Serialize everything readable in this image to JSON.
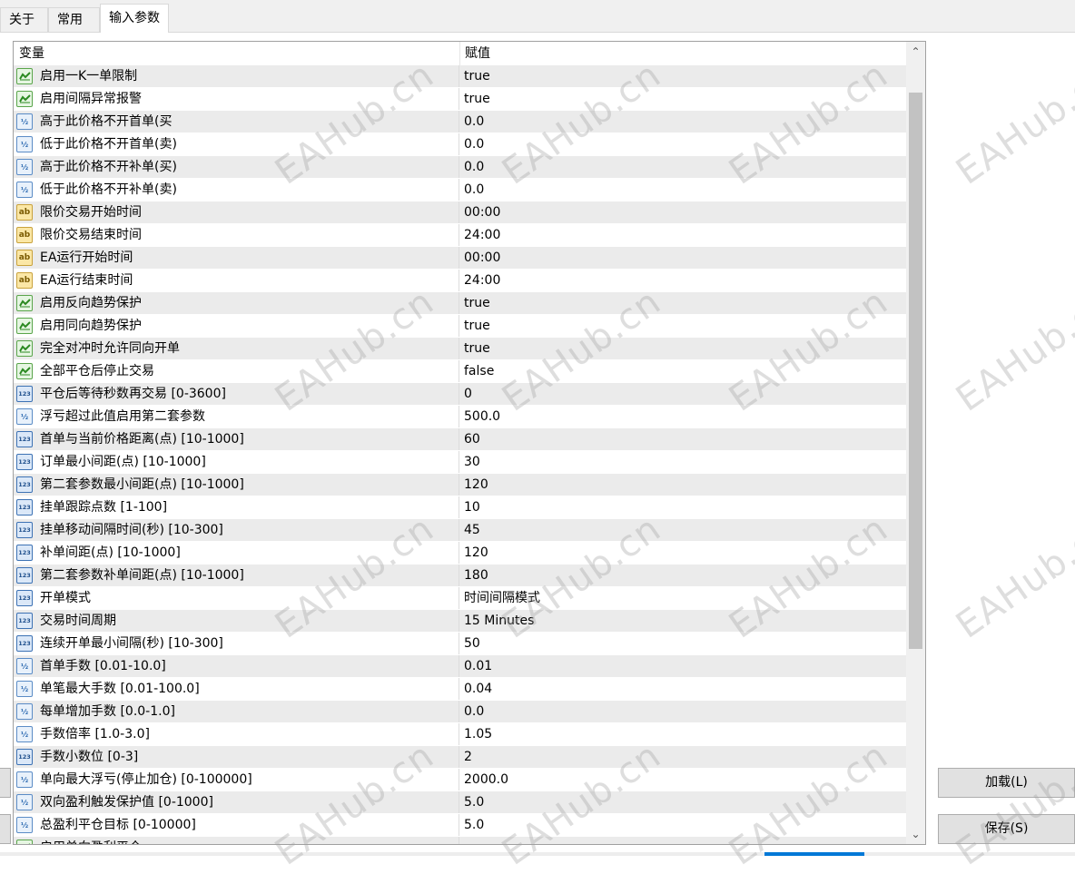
{
  "tabs": [
    {
      "label": "关于"
    },
    {
      "label": "常用"
    },
    {
      "label": "输入参数"
    }
  ],
  "grid": {
    "columns": {
      "name": "变量",
      "value": "赋值"
    },
    "rows": [
      {
        "icon": "bool",
        "name": "启用一K一单限制",
        "value": "true"
      },
      {
        "icon": "bool",
        "name": "启用间隔异常报警",
        "value": "true"
      },
      {
        "icon": "double",
        "name": "高于此价格不开首单(买",
        "value": "0.0"
      },
      {
        "icon": "double",
        "name": "低于此价格不开首单(卖)",
        "value": "0.0"
      },
      {
        "icon": "double",
        "name": "高于此价格不开补单(买)",
        "value": "0.0"
      },
      {
        "icon": "double",
        "name": "低于此价格不开补单(卖)",
        "value": "0.0"
      },
      {
        "icon": "string",
        "name": "限价交易开始时间",
        "value": "00:00"
      },
      {
        "icon": "string",
        "name": "限价交易结束时间",
        "value": "24:00"
      },
      {
        "icon": "string",
        "name": "EA运行开始时间",
        "value": "00:00"
      },
      {
        "icon": "string",
        "name": "EA运行结束时间",
        "value": "24:00"
      },
      {
        "icon": "bool",
        "name": "启用反向趋势保护",
        "value": "true"
      },
      {
        "icon": "bool",
        "name": "启用同向趋势保护",
        "value": "true"
      },
      {
        "icon": "bool",
        "name": "完全对冲时允许同向开单",
        "value": "true"
      },
      {
        "icon": "bool",
        "name": "全部平仓后停止交易",
        "value": "false"
      },
      {
        "icon": "int",
        "name": "平仓后等待秒数再交易 [0-3600]",
        "value": "0"
      },
      {
        "icon": "double",
        "name": "浮亏超过此值启用第二套参数",
        "value": "500.0"
      },
      {
        "icon": "int",
        "name": "首单与当前价格距离(点) [10-1000]",
        "value": "60"
      },
      {
        "icon": "int",
        "name": "订单最小间距(点) [10-1000]",
        "value": "30"
      },
      {
        "icon": "int",
        "name": "第二套参数最小间距(点) [10-1000]",
        "value": "120"
      },
      {
        "icon": "int",
        "name": "挂单跟踪点数 [1-100]",
        "value": "10"
      },
      {
        "icon": "int",
        "name": "挂单移动间隔时间(秒) [10-300]",
        "value": "45"
      },
      {
        "icon": "int",
        "name": "补单间距(点) [10-1000]",
        "value": "120"
      },
      {
        "icon": "int",
        "name": "第二套参数补单间距(点) [10-1000]",
        "value": "180"
      },
      {
        "icon": "int",
        "name": "开单模式",
        "value": "时间间隔模式"
      },
      {
        "icon": "int",
        "name": "交易时间周期",
        "value": "15 Minutes"
      },
      {
        "icon": "int",
        "name": "连续开单最小间隔(秒) [10-300]",
        "value": "50"
      },
      {
        "icon": "double",
        "name": "首单手数 [0.01-10.0]",
        "value": "0.01"
      },
      {
        "icon": "double",
        "name": "单笔最大手数 [0.01-100.0]",
        "value": "0.04"
      },
      {
        "icon": "double",
        "name": "每单增加手数 [0.0-1.0]",
        "value": "0.0"
      },
      {
        "icon": "double",
        "name": "手数倍率 [1.0-3.0]",
        "value": "1.05"
      },
      {
        "icon": "int",
        "name": "手数小数位 [0-3]",
        "value": "2"
      },
      {
        "icon": "double",
        "name": "单向最大浮亏(停止加仓) [0-100000]",
        "value": "2000.0"
      },
      {
        "icon": "double",
        "name": "双向盈利触发保护值 [0-1000]",
        "value": "5.0"
      },
      {
        "icon": "double",
        "name": "总盈利平仓目标 [0-10000]",
        "value": "5.0"
      },
      {
        "icon": "bool",
        "name": "启用单向盈利平仓",
        "value": ""
      }
    ]
  },
  "scrollbar": {
    "position_fraction": 0.04,
    "visible_fraction": 0.73
  },
  "buttons": {
    "load": "加载(L)",
    "save": "保存(S)"
  },
  "watermark": "EAHub.cn",
  "colors": {
    "row_alt": "#ebebeb",
    "accent": "#0078d7",
    "button": "#e1e1e1"
  }
}
